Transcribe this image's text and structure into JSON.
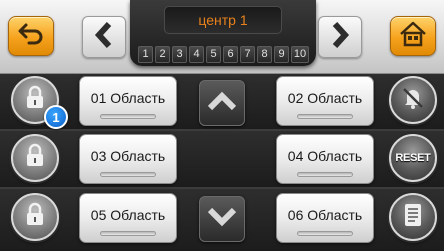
{
  "header": {
    "title": "центр 1",
    "pages": [
      "1",
      "2",
      "3",
      "4",
      "5",
      "6",
      "7",
      "8",
      "9",
      "10"
    ]
  },
  "icons": {
    "back": "back-arrow-icon",
    "home": "home-icon",
    "prev": "chevron-left-icon",
    "next": "chevron-right-icon",
    "lock": "lock-icon",
    "scroll_up": "chevron-up-icon",
    "scroll_down": "chevron-down-icon",
    "mute": "bell-off-icon",
    "log": "document-icon"
  },
  "areas": {
    "a01": "01 Область",
    "a02": "02 Область",
    "a03": "03 Область",
    "a04": "04 Область",
    "a05": "05 Область",
    "a06": "06 Область"
  },
  "badge": "1",
  "reset_label": "RESET",
  "colors": {
    "accent_orange": "#f6a21d",
    "title_text": "#e9821c",
    "badge_blue": "#1a7ee6"
  }
}
